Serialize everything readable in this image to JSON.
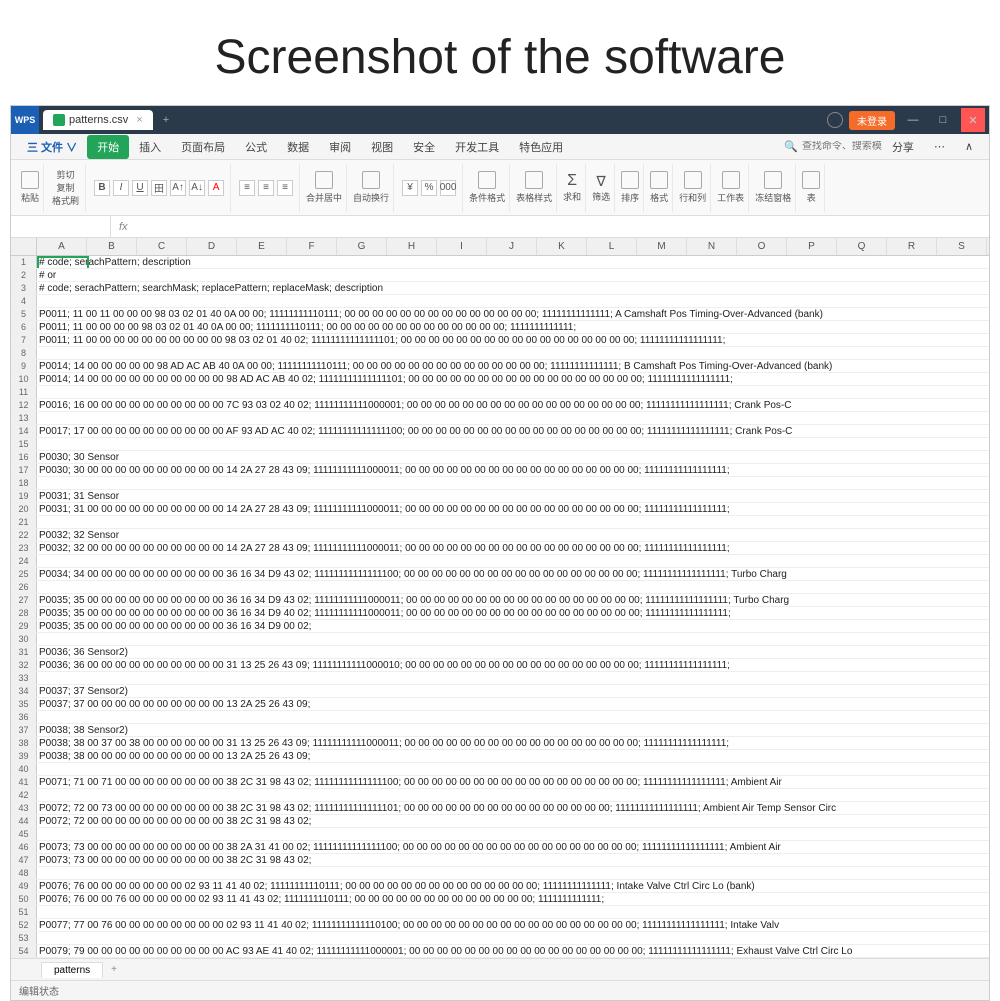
{
  "page_heading": "Screenshot of the software",
  "titlebar": {
    "logo": "WPS",
    "file_tab": "patterns.csv",
    "login": "未登录"
  },
  "menubar": {
    "file": "三 文件 ∨",
    "items": [
      "开始",
      "插入",
      "页面布局",
      "公式",
      "数据",
      "审阅",
      "视图",
      "安全",
      "开发工具",
      "特色应用"
    ],
    "search_icon": "🔍",
    "search_placeholder": "查找命令、搜索模板",
    "right": [
      "分享",
      "⋯",
      "∧"
    ]
  },
  "ribbon": {
    "g1": "粘贴",
    "g1a": "剪切",
    "g1b": "复制",
    "g1c": "格式刷",
    "merge": "合并居中",
    "wrap": "自动换行",
    "cond": "条件格式",
    "tstyle": "表格样式",
    "sum": "求和",
    "filter": "筛选",
    "sort": "排序",
    "fmt": "格式",
    "rc": "行和列",
    "ws": "工作表",
    "freeze": "冻结窗格",
    "tbl": "表"
  },
  "formula": {
    "cell": "",
    "fx": "fx"
  },
  "columns": [
    "A",
    "B",
    "C",
    "D",
    "E",
    "F",
    "G",
    "H",
    "I",
    "J",
    "K",
    "L",
    "M",
    "N",
    "O",
    "P",
    "Q",
    "R",
    "S"
  ],
  "rows": [
    {
      "n": 1,
      "t": "# code; serachPattern; description",
      "sel": true
    },
    {
      "n": 2,
      "t": "# or"
    },
    {
      "n": 3,
      "t": "# code; serachPattern; searchMask; replacePattern; replaceMask; description"
    },
    {
      "n": 4,
      "t": ""
    },
    {
      "n": 5,
      "t": "P0011; 11 00 11 00 00 00 98 03 02 01 40 0A 00 00; 11111111110111; 00 00 00 00 00 00 00 00 00 00 00 00 00 00; 11111111111111; A Camshaft Pos Timing-Over-Advanced (bank)"
    },
    {
      "n": 6,
      "t": "P0011; 11 00 00 00 00 98 03 02 01 40 0A 00 00; 1111111110111; 00 00 00 00 00 00 00 00 00 00 00 00 00; 1111111111111;"
    },
    {
      "n": 7,
      "t": "P0011; 11 00 00 00 00 00 00 00 00 00 00 98 03 02 01 40 02; 11111111111111101; 00 00 00 00 00 00 00 00 00 00 00 00 00 00 00 00 00; 11111111111111111;"
    },
    {
      "n": 8,
      "t": ""
    },
    {
      "n": 9,
      "t": "P0014; 14 00 00 00 00 00 98 AD AC AB 40 0A 00 00; 11111111110111; 00 00 00 00 00 00 00 00 00 00 00 00 00 00; 11111111111111; B Camshaft Pos Timing-Over-Advanced (bank)"
    },
    {
      "n": 10,
      "t": "P0014; 14 00 00 00 00 00 00 00 00 00 00 98 AD AC AB 40 02; 11111111111111101; 00 00 00 00 00 00 00 00 00 00 00 00 00 00 00 00 00; 11111111111111111;"
    },
    {
      "n": 11,
      "t": ""
    },
    {
      "n": 12,
      "t": "P0016; 16 00 00 00 00 00 00 00 00 00 00 7C 93 03 02 40 02; 11111111111000001; 00 00 00 00 00 00 00 00 00 00 00 00 00 00 00 00 00; 11111111111111111; Crank Pos-C"
    },
    {
      "n": 13,
      "t": ""
    },
    {
      "n": 14,
      "t": "P0017; 17 00 00 00 00 00 00 00 00 00 00 AF 93 AD AC 40 02; 11111111111111100; 00 00 00 00 00 00 00 00 00 00 00 00 00 00 00 00 00; 11111111111111111; Crank Pos-C"
    },
    {
      "n": 15,
      "t": ""
    },
    {
      "n": 16,
      "t": "P0030; 30 Sensor"
    },
    {
      "n": 17,
      "t": "P0030; 30 00 00 00 00 00 00 00 00 00 00 14 2A 27 28 43 09; 11111111111000011; 00 00 00 00 00 00 00 00 00 00 00 00 00 00 00 00 00; 11111111111111111;"
    },
    {
      "n": 18,
      "t": ""
    },
    {
      "n": 19,
      "t": "P0031; 31 Sensor"
    },
    {
      "n": 20,
      "t": "P0031; 31 00 00 00 00 00 00 00 00 00 00 14 2A 27 28 43 09; 11111111111000011; 00 00 00 00 00 00 00 00 00 00 00 00 00 00 00 00 00; 11111111111111111;"
    },
    {
      "n": 21,
      "t": ""
    },
    {
      "n": 22,
      "t": "P0032; 32 Sensor"
    },
    {
      "n": 23,
      "t": "P0032; 32 00 00 00 00 00 00 00 00 00 00 14 2A 27 28 43 09; 11111111111000011; 00 00 00 00 00 00 00 00 00 00 00 00 00 00 00 00 00; 11111111111111111;"
    },
    {
      "n": 24,
      "t": ""
    },
    {
      "n": 25,
      "t": "P0034; 34 00 00 00 00 00 00 00 00 00 00 36 16 34 D9 43 02; 11111111111111100; 00 00 00 00 00 00 00 00 00 00 00 00 00 00 00 00 00; 11111111111111111; Turbo Charg"
    },
    {
      "n": 26,
      "t": ""
    },
    {
      "n": 27,
      "t": "P0035; 35 00 00 00 00 00 00 00 00 00 00 36 16 34 D9 43 02; 11111111111000011; 00 00 00 00 00 00 00 00 00 00 00 00 00 00 00 00 00; 11111111111111111; Turbo Charg"
    },
    {
      "n": 28,
      "t": "P0035; 35 00 00 00 00 00 00 00 00 00 00 36 16 34 D9 40 02; 11111111111000011; 00 00 00 00 00 00 00 00 00 00 00 00 00 00 00 00 00; 11111111111111111;"
    },
    {
      "n": 29,
      "t": "P0035; 35 00 00 00 00 00 00 00 00 00 00 36 16 34 D9 00 02;"
    },
    {
      "n": 30,
      "t": ""
    },
    {
      "n": 31,
      "t": "P0036; 36 Sensor2)"
    },
    {
      "n": 32,
      "t": "P0036; 36 00 00 00 00 00 00 00 00 00 00 31 13 25 26 43 09; 11111111111000010; 00 00 00 00 00 00 00 00 00 00 00 00 00 00 00 00 00; 11111111111111111;"
    },
    {
      "n": 33,
      "t": ""
    },
    {
      "n": 34,
      "t": "P0037; 37 Sensor2)"
    },
    {
      "n": 35,
      "t": "P0037; 37 00 00 00 00 00 00 00 00 00 00 13 2A 25 26 43 09;"
    },
    {
      "n": 36,
      "t": ""
    },
    {
      "n": 37,
      "t": "P0038; 38 Sensor2)"
    },
    {
      "n": 38,
      "t": "P0038; 38 00 37 00 38 00 00 00 00 00 00 31 13 25 26 43 09; 11111111111000011; 00 00 00 00 00 00 00 00 00 00 00 00 00 00 00 00 00; 11111111111111111;"
    },
    {
      "n": 39,
      "t": "P0038; 38 00 00 00 00 00 00 00 00 00 00 13 2A 25 26 43 09;"
    },
    {
      "n": 40,
      "t": ""
    },
    {
      "n": 41,
      "t": "P0071; 71 00 71 00 00 00 00 00 00 00 00 38 2C 31 98 43 02; 11111111111111100; 00 00 00 00 00 00 00 00 00 00 00 00 00 00 00 00 00; 11111111111111111; Ambient Air"
    },
    {
      "n": 42,
      "t": ""
    },
    {
      "n": 43,
      "t": "P0072; 72 00 73 00 00 00 00 00 00 00 00 38 2C 31 98 43 02; 11111111111111101; 00 00 00 00 00 00 00 00 00 00 00 00 00 00 00; 11111111111111111; Ambient Air Temp Sensor Circ"
    },
    {
      "n": 44,
      "t": "P0072; 72 00 00 00 00 00 00 00 00 00 00 38 2C 31 98 43 02;"
    },
    {
      "n": 45,
      "t": ""
    },
    {
      "n": 46,
      "t": "P0073; 73 00 00 00 00 00 00 00 00 00 00 38 2A 31 41 00 02; 11111111111111100; 00 00 00 00 00 00 00 00 00 00 00 00 00 00 00 00 00; 11111111111111111; Ambient Air"
    },
    {
      "n": 47,
      "t": "P0073; 73 00 00 00 00 00 00 00 00 00 00 38 2C 31 98 43 02;"
    },
    {
      "n": 48,
      "t": ""
    },
    {
      "n": 49,
      "t": "P0076; 76 00 00 00 00 00 00 00 02 93 11 41 40 02; 11111111110111; 00 00 00 00 00 00 00 00 00 00 00 00 00 00; 11111111111111; Intake Valve Ctrl Circ Lo (bank)"
    },
    {
      "n": 50,
      "t": "P0076; 76 00 00 76 00 00 00 00 00 02 93 11 41 43 02; 1111111110111; 00 00 00 00 00 00 00 00 00 00 00 00 00; 1111111111111;"
    },
    {
      "n": 51,
      "t": ""
    },
    {
      "n": 52,
      "t": "P0077; 77 00 76 00 00 00 00 00 00 00 00 02 93 11 41 40 02; 11111111111110100; 00 00 00 00 00 00 00 00 00 00 00 00 00 00 00 00 00; 11111111111111111; Intake Valv"
    },
    {
      "n": 53,
      "t": ""
    },
    {
      "n": 54,
      "t": "P0079; 79 00 00 00 00 00 00 00 00 00 00 AC 93 AE 41 40 02; 11111111111000001; 00 00 00 00 00 00 00 00 00 00 00 00 00 00 00 00 00; 11111111111111111; Exhaust Valve Ctrl Circ Lo"
    }
  ],
  "sheet_tab": "patterns",
  "status": "编辑状态"
}
